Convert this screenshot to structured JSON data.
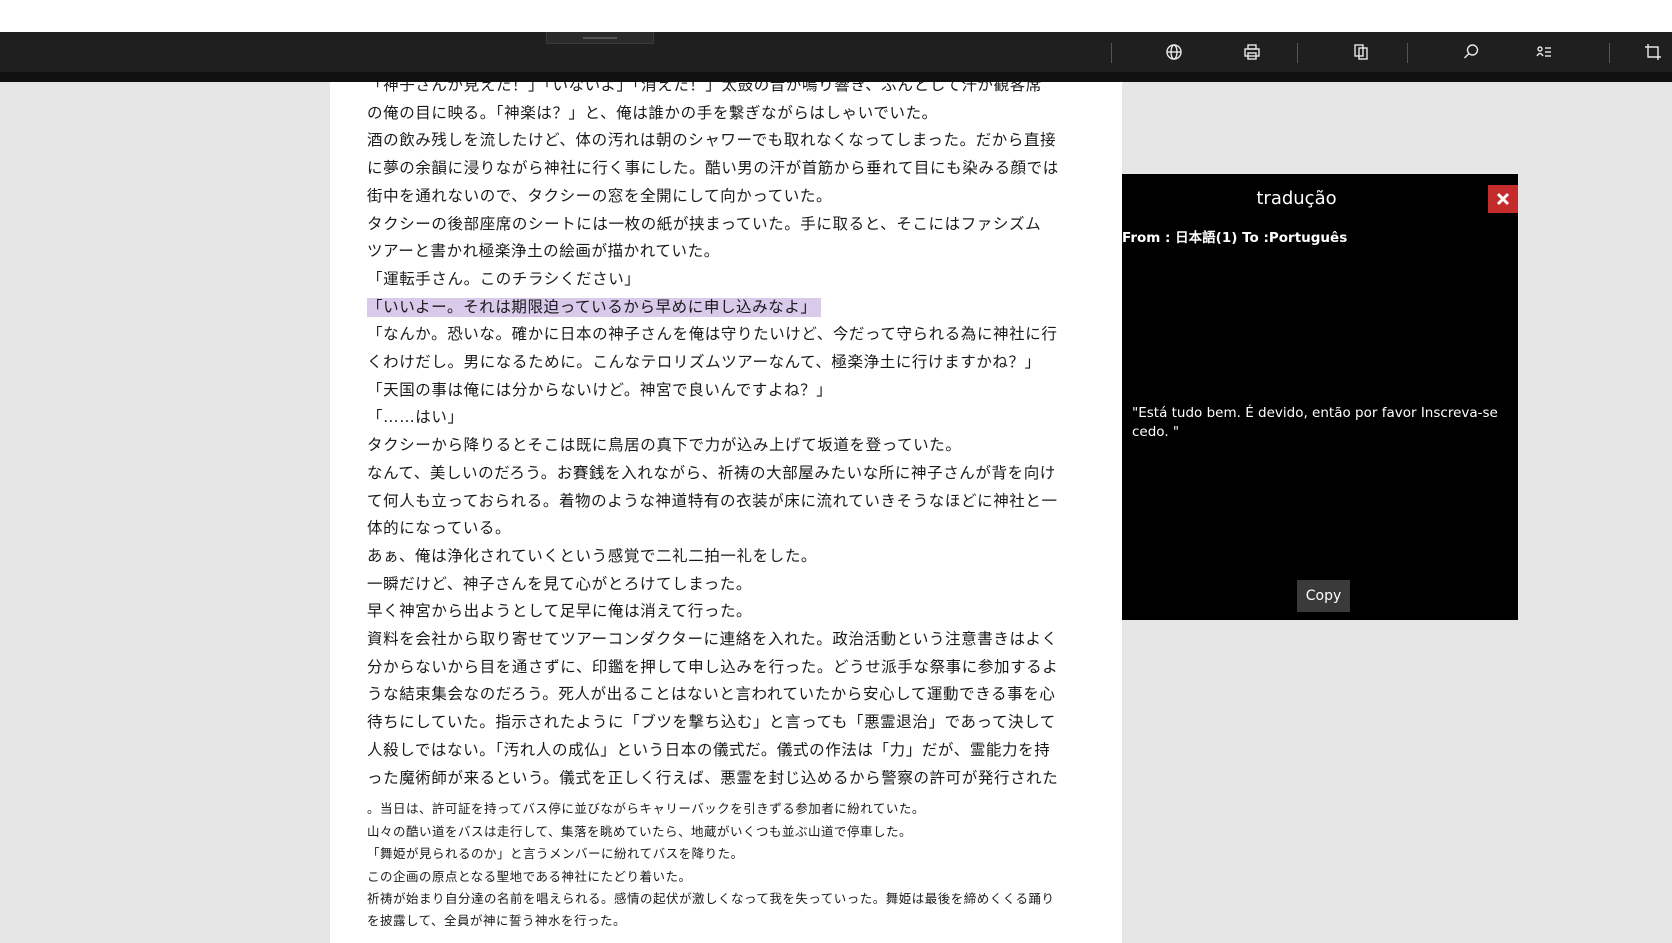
{
  "toolbar": {
    "icons": [
      "globe-icon",
      "print-icon",
      "copy-pages-icon",
      "search-icon",
      "reading-list-icon",
      "crop-icon"
    ]
  },
  "document": {
    "large_lines": [
      "「神子さんが見えた！」「いないよ」「消えた！」太鼓の音が鳴り響き、ぶんとして汗が観客席",
      "の俺の目に映る。「神楽は？」と、俺は誰かの手を繋ぎながらはしゃいでいた。",
      "酒の飲み残しを流したけど、体の汚れは朝のシャワーでも取れなくなってしまった。だから直接",
      "に夢の余韻に浸りながら神社に行く事にした。酷い男の汗が首筋から垂れて目にも染みる顔では",
      "街中を通れないので、タクシーの窓を全開にして向かっていた。",
      "タクシーの後部座席のシートには一枚の紙が挟まっていた。手に取ると、そこにはファシズム",
      "ツアーと書かれ極楽浄土の絵画が描かれていた。",
      "「運転手さん。このチラシください」",
      "「いいよー。それは期限迫っているから早めに申し込みなよ」",
      "「なんか。恐いな。確かに日本の神子さんを俺は守りたいけど、今だって守られる為に神社に行",
      "くわけだし。男になるために。こんなテロリズムツアーなんて、極楽浄土に行けますかね？」",
      "「天国の事は俺には分からないけど。神宮で良いんですよね？」",
      "「……はい」",
      "タクシーから降りるとそこは既に鳥居の真下で力が込み上げて坂道を登っていた。",
      "なんて、美しいのだろう。お賽銭を入れながら、祈祷の大部屋みたいな所に神子さんが背を向け",
      "て何人も立っておられる。着物のような神道特有の衣装が床に流れていきそうなほどに神社と一",
      "体的になっている。",
      "あぁ、俺は浄化されていくという感覚で二礼二拍一礼をした。",
      "一瞬だけど、神子さんを見て心がとろけてしまった。",
      "早く神宮から出ようとして足早に俺は消えて行った。",
      "資料を会社から取り寄せてツアーコンダクターに連絡を入れた。政治活動という注意書きはよく",
      "分からないから目を通さずに、印鑑を押して申し込みを行った。どうせ派手な祭事に参加するよ",
      "うな結束集会なのだろう。死人が出ることはないと言われていたから安心して運動できる事を心",
      "待ちにしていた。指示されたように「ブツを撃ち込む」と言っても「悪霊退治」であって決して",
      "人殺しではない。「汚れ人の成仏」という日本の儀式だ。儀式の作法は「力」だが、霊能力を持",
      "った魔術師が来るという。儀式を正しく行えば、悪霊を封じ込めるから警察の許可が発行された"
    ],
    "small_lines": [
      "。当日は、許可証を持ってバス停に並びながらキャリーバックを引きずる参加者に紛れていた。",
      "山々の酷い道をバスは走行して、集落を眺めていたら、地蔵がいくつも並ぶ山道で停車した。",
      "「舞姫が見られるのか」と言うメンバーに紛れてバスを降りた。",
      "この企画の原点となる聖地である神社にたどり着いた。",
      "祈祷が始まり自分達の名前を唱えられる。感情の起伏が激しくなって我を失っていった。舞姫は最後を締めくくる踊り",
      "を披露して、全員が神に誓う神水を行った。"
    ],
    "highlight_index": 8,
    "highlight_color": "#d9c9ea"
  },
  "translation_panel": {
    "title": "tradução",
    "from_to": "From : 日本語(1) To :Português",
    "text": "\"Está tudo bem. É devido, então por favor Inscreva-se cedo. \"",
    "copy_label": "Copy",
    "close_icon": "close-icon",
    "close_color": "#c42b2b"
  }
}
